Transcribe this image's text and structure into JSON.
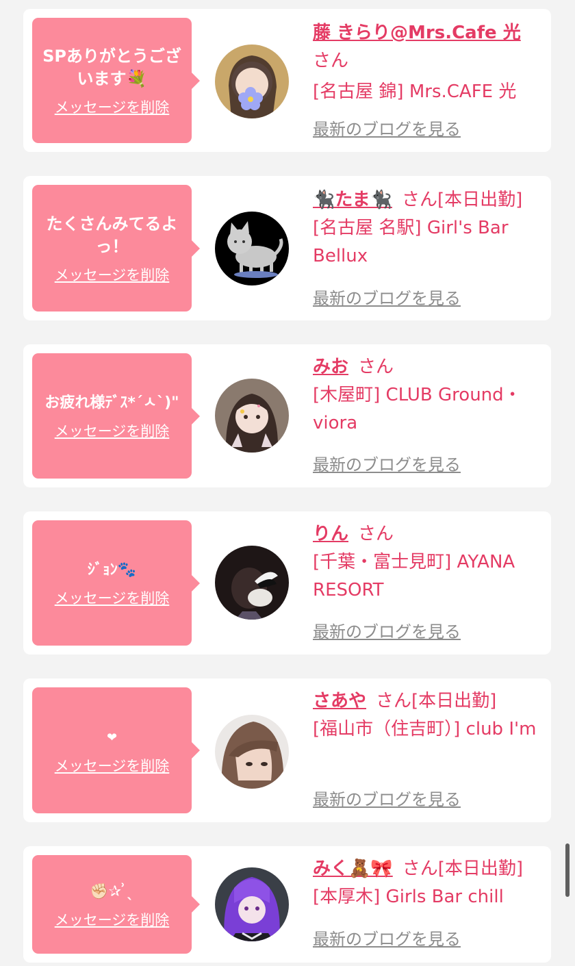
{
  "list": {
    "cards": [
      {
        "message": "SPありがとうございます💐",
        "delete_label": "メッセージを削除",
        "name": "藤 きらり@Mrs.Cafe 光",
        "honorific": "さん",
        "status": "",
        "shop": "[名古屋 錦] Mrs.CAFE 光",
        "blog_label": "最新のブログを見る"
      },
      {
        "message": "たくさんみてるよっ！",
        "delete_label": "メッセージを削除",
        "name": "🐈‍⬛たま🐈‍⬛",
        "honorific": "さん",
        "status": "[本日出勤]",
        "shop": "[名古屋 名駅] Girl's Bar Bellux",
        "blog_label": "最新のブログを見る"
      },
      {
        "message": "お疲れ様ﾃﾞｽ*´ㅅ`)\"",
        "delete_label": "メッセージを削除",
        "name": "みお",
        "honorific": "さん",
        "status": "",
        "shop": "[木屋町] CLUB Ground・viora",
        "blog_label": "最新のブログを見る"
      },
      {
        "message": "ｼﾞｮﾝ🐾",
        "delete_label": "メッセージを削除",
        "name": "りん",
        "honorific": "さん",
        "status": "",
        "shop": "[千葉・富士見町] AYANA RESORT",
        "blog_label": "最新のブログを見る"
      },
      {
        "message": "❤",
        "delete_label": "メッセージを削除",
        "name": "さあや",
        "honorific": "さん",
        "status": "[本日出勤]",
        "shop": "[福山市（住吉町）] club I'm",
        "blog_label": "最新のブログを見る"
      },
      {
        "message": "✊🏻✰ ͗ˎ",
        "delete_label": "メッセージを削除",
        "name": "みく🧸🎀",
        "honorific": "さん",
        "status": "[本日出勤]",
        "shop": "[本厚木] Girls Bar chill",
        "blog_label": "最新のブログを見る"
      }
    ]
  },
  "colors": {
    "page_bg": "#f3f3f3",
    "card_bg": "#ffffff",
    "bubble_bg": "#fc8a9b",
    "accent": "#e43b64",
    "link_gray": "#8c8c8c"
  }
}
